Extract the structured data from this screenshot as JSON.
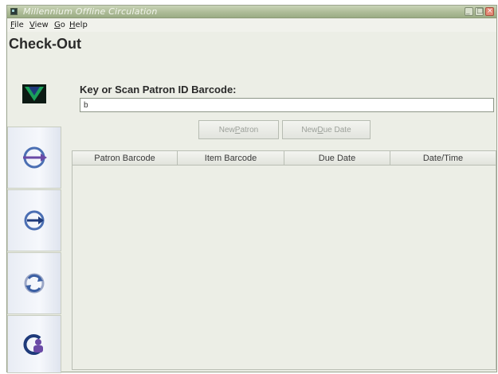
{
  "window": {
    "title": "Millennium Offline Circulation"
  },
  "menu": [
    {
      "label": "File",
      "mnemonic": "F",
      "rest": "ile"
    },
    {
      "label": "View",
      "mnemonic": "V",
      "rest": "iew"
    },
    {
      "label": "Go",
      "mnemonic": "G",
      "rest": "o"
    },
    {
      "label": "Help",
      "mnemonic": "H",
      "rest": "elp"
    }
  ],
  "page": {
    "title": "Check-Out"
  },
  "sidebar": {
    "items": [
      {
        "name": "logo",
        "icon": "millennium-logo-icon"
      },
      {
        "name": "check-out",
        "icon": "check-out-arrow-icon"
      },
      {
        "name": "check-in",
        "icon": "check-in-arrow-icon"
      },
      {
        "name": "renew",
        "icon": "renew-cycle-icon"
      },
      {
        "name": "patrons",
        "icon": "patron-icon"
      }
    ]
  },
  "checkout": {
    "prompt": "Key or Scan Patron ID Barcode:",
    "barcode_value": "b",
    "buttons": {
      "new_patron": {
        "pre": "New ",
        "mnemonic": "P",
        "post": "atron"
      },
      "new_due_date": {
        "pre": "New ",
        "mnemonic": "D",
        "post": "ue Date"
      }
    },
    "table": {
      "columns": [
        "Patron Barcode",
        "Item Barcode",
        "Due Date",
        "Date/Time"
      ],
      "rows": []
    }
  },
  "colors": {
    "titlebar": "#aebc98",
    "window_bg": "#eceee6",
    "accent_purple": "#6a4aa6",
    "logo_green": "#1aa05a",
    "logo_blue": "#1e3a7a"
  }
}
